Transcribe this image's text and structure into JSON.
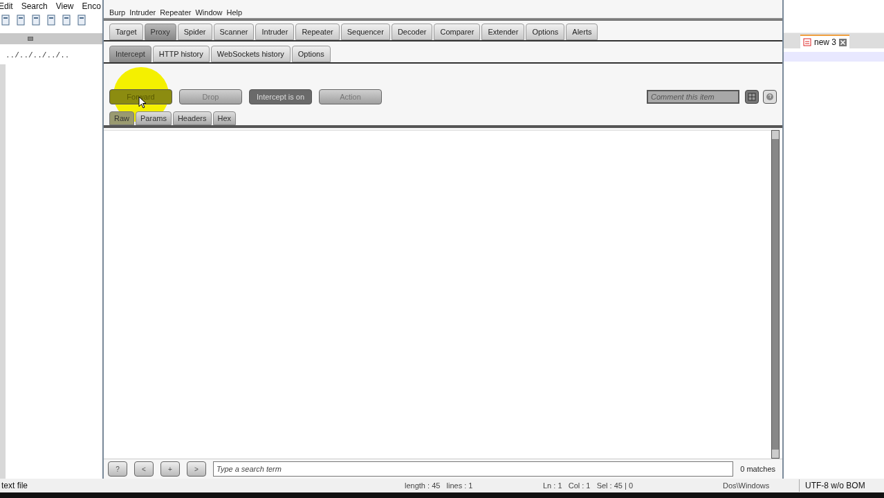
{
  "editor": {
    "menu": [
      "Edit",
      "Search",
      "View",
      "Enco"
    ],
    "ruler": "../../../../..",
    "tab": {
      "label": "new 3"
    },
    "status": {
      "file_type": "text file",
      "length": "length : 45   lines : 1",
      "position": "Ln : 1   Col : 1   Sel : 45 | 0",
      "eol": "Dos\\Windows",
      "encoding": "UTF-8 w/o BOM"
    }
  },
  "burp": {
    "menu": [
      "Burp",
      "Intruder",
      "Repeater",
      "Window",
      "Help"
    ],
    "tabs": [
      {
        "label": "Target",
        "selected": false
      },
      {
        "label": "Proxy",
        "selected": true
      },
      {
        "label": "Spider",
        "selected": false
      },
      {
        "label": "Scanner",
        "selected": false
      },
      {
        "label": "Intruder",
        "selected": false
      },
      {
        "label": "Repeater",
        "selected": false
      },
      {
        "label": "Sequencer",
        "selected": false
      },
      {
        "label": "Decoder",
        "selected": false
      },
      {
        "label": "Comparer",
        "selected": false
      },
      {
        "label": "Extender",
        "selected": false
      },
      {
        "label": "Options",
        "selected": false
      },
      {
        "label": "Alerts",
        "selected": false
      }
    ],
    "subtabs": [
      {
        "label": "Intercept",
        "selected": true
      },
      {
        "label": "HTTP history",
        "selected": false
      },
      {
        "label": "WebSockets history",
        "selected": false
      },
      {
        "label": "Options",
        "selected": false
      }
    ],
    "actions": [
      {
        "label": "Forward",
        "kind": "highlighted"
      },
      {
        "label": "Drop",
        "kind": "normal"
      },
      {
        "label": "Intercept is on",
        "kind": "toggle"
      },
      {
        "label": "Action",
        "kind": "normal"
      }
    ],
    "comment": {
      "placeholder": "Comment this item"
    },
    "message_tabs": [
      {
        "label": "Raw",
        "selected": true
      },
      {
        "label": "Params",
        "selected": false
      },
      {
        "label": "Headers",
        "selected": false
      },
      {
        "label": "Hex",
        "selected": false
      }
    ],
    "search": {
      "buttons": [
        "?",
        "<",
        "+",
        ">"
      ],
      "placeholder": "Type a search term",
      "matches": "0 matches"
    }
  }
}
